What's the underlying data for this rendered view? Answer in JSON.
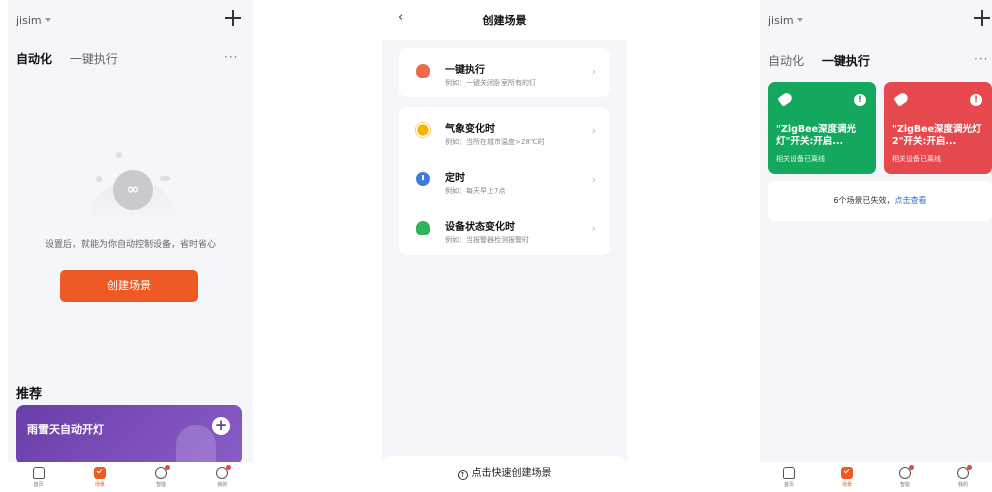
{
  "screen1": {
    "account": "jisim",
    "tabs": [
      "自动化",
      "一键执行"
    ],
    "more": "···",
    "empty_text": "设置后，就能为你自动控制设备，省时省心",
    "create_button": "创建场景",
    "recommend_title": "推荐",
    "recommend_card": "雨雪天自动开灯",
    "nav": [
      "首页",
      "场景",
      "智能",
      "我的"
    ]
  },
  "screen2": {
    "title": "创建场景",
    "options": [
      {
        "name": "一键执行",
        "desc": "例如：一键关闭卧室所有的灯",
        "icon": "hand-tap-icon"
      },
      {
        "name": "气象变化时",
        "desc": "例如：当所在城市温度>28℃时",
        "icon": "sun-icon"
      },
      {
        "name": "定时",
        "desc": "例如：每天早上7点",
        "icon": "clock-icon"
      },
      {
        "name": "设备状态变化时",
        "desc": "例如：当报警器检测报警时",
        "icon": "bulb-icon"
      }
    ],
    "footer": "点击快速创建场景"
  },
  "screen3": {
    "account": "jisim",
    "tabs": [
      "自动化",
      "一键执行"
    ],
    "more": "···",
    "cards": [
      {
        "name": "\"ZigBee深度调光灯\"开关:开启...",
        "sub": "相关设备已离线",
        "color": "#14a85e"
      },
      {
        "name": "\"ZigBee深度调光灯 2\"开关:开启...",
        "sub": "相关设备已离线",
        "color": "#e5484d"
      }
    ],
    "invalid_text": "6个场景已失效，",
    "invalid_link": "点击查看",
    "nav": [
      "首页",
      "场景",
      "智能",
      "我的"
    ]
  },
  "colors": {
    "accent": "#ee5a24",
    "green": "#14a85e",
    "red": "#e5484d",
    "link": "#2b6fd6"
  }
}
